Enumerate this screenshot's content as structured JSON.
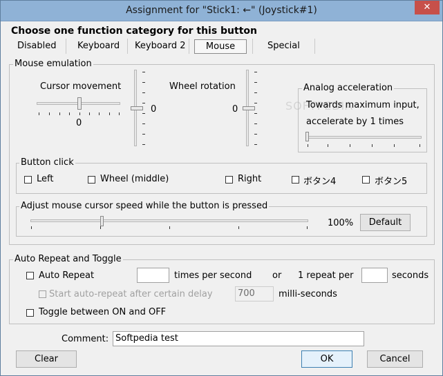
{
  "window": {
    "title": "Assignment for \"Stick1: ←\" (Joystick#1)",
    "close_glyph": "✕",
    "watermark": "SOFTPEDIA"
  },
  "header": {
    "instruction": "Choose one function category for this button"
  },
  "tabs": [
    {
      "label": "Disabled",
      "selected": false
    },
    {
      "label": "Keyboard",
      "selected": false
    },
    {
      "label": "Keyboard 2",
      "selected": false
    },
    {
      "label": "Mouse",
      "selected": true
    },
    {
      "label": "Special",
      "selected": false
    }
  ],
  "mouse_emulation": {
    "legend": "Mouse emulation",
    "cursor_movement": {
      "label": "Cursor movement",
      "h_value": "0",
      "v_value": "0"
    },
    "wheel_rotation": {
      "label": "Wheel rotation",
      "v_value": "0"
    },
    "analog": {
      "legend": "Analog acceleration",
      "line1": "Towards maximum input,",
      "line2": "accelerate by 1 times"
    }
  },
  "button_click": {
    "legend": "Button click",
    "options": [
      "Left",
      "Wheel (middle)",
      "Right",
      "ボタン4",
      "ボタン5"
    ]
  },
  "cursor_speed": {
    "legend": "Adjust mouse cursor speed while the button is pressed",
    "value": "100%",
    "default_label": "Default"
  },
  "auto_repeat": {
    "legend": "Auto Repeat and Toggle",
    "auto_repeat_label": "Auto Repeat",
    "times_value": "",
    "times_label": "times per second",
    "or_label": "or",
    "repeat_per_label": "1 repeat per",
    "seconds_value": "",
    "seconds_label": "seconds",
    "delay_label": "Start auto-repeat after certain delay",
    "delay_value": "700",
    "delay_unit": "milli-seconds",
    "toggle_label": "Toggle between ON and OFF"
  },
  "comment": {
    "label": "Comment:",
    "value": "Softpedia test"
  },
  "footer": {
    "clear": "Clear",
    "ok": "OK",
    "cancel": "Cancel"
  }
}
